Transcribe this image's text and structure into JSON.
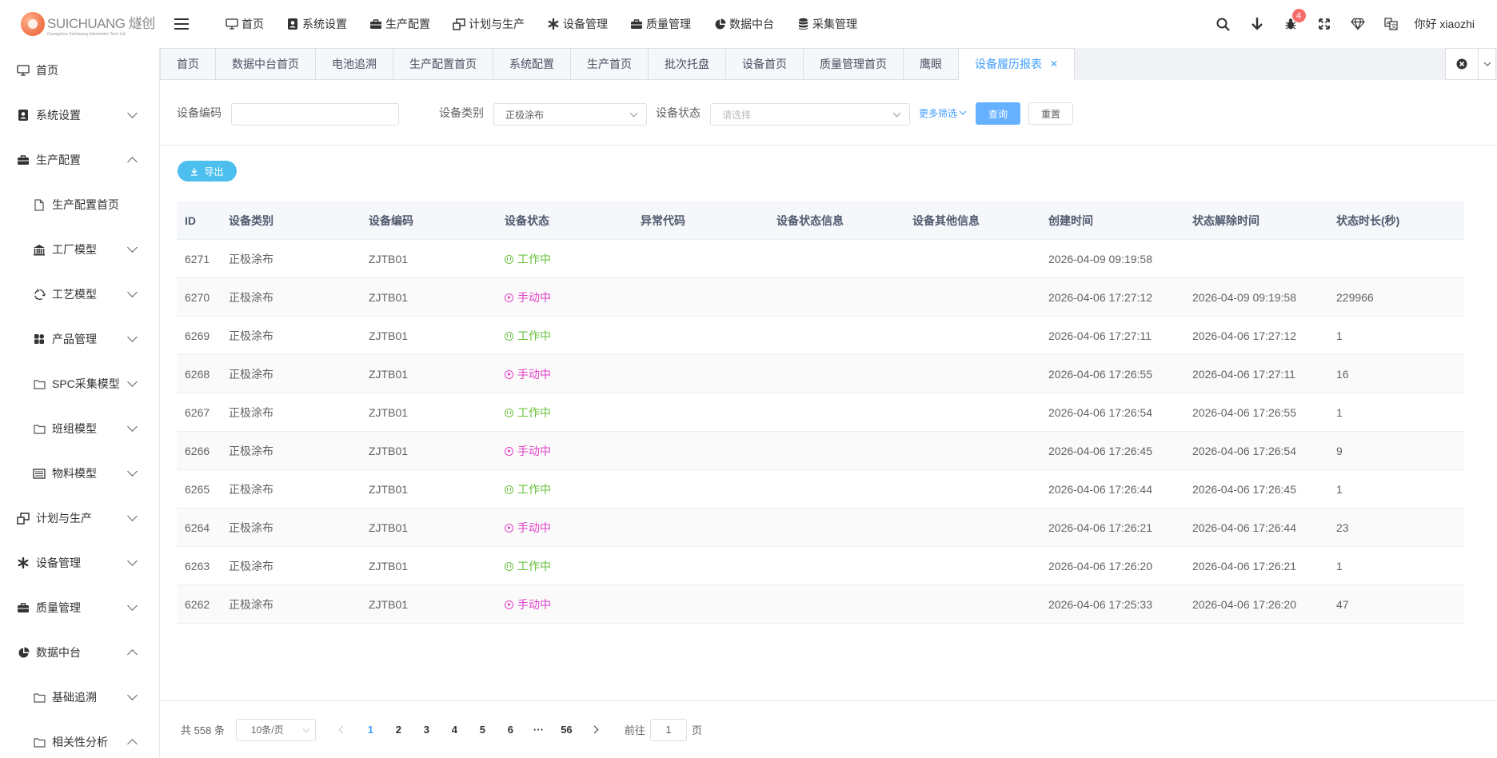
{
  "logo": {
    "name": "SUICHUANG 燧创",
    "sub": "Guangzhou Suichuang Information Tech Ltd"
  },
  "topnav": [
    {
      "label": "首页",
      "icon": "monitor-icon"
    },
    {
      "label": "系统设置",
      "icon": "user-badge-icon"
    },
    {
      "label": "生产配置",
      "icon": "briefcase-icon"
    },
    {
      "label": "计划与生产",
      "icon": "windows-icon"
    },
    {
      "label": "设备管理",
      "icon": "asterisk-icon"
    },
    {
      "label": "质量管理",
      "icon": "briefcase-icon"
    },
    {
      "label": "数据中台",
      "icon": "pie-chart-icon"
    },
    {
      "label": "采集管理",
      "icon": "database-icon"
    }
  ],
  "top_right": {
    "badge_count": "4",
    "greeting": "你好 xiaozhi"
  },
  "sidebar": [
    {
      "label": "首页",
      "icon": "monitor-icon",
      "level": 1,
      "chevron": ""
    },
    {
      "label": "系统设置",
      "icon": "user-badge-icon",
      "level": 1,
      "chevron": "down"
    },
    {
      "label": "生产配置",
      "icon": "briefcase-icon",
      "level": 1,
      "chevron": "up"
    },
    {
      "label": "生产配置首页",
      "icon": "document-icon",
      "level": 2,
      "chevron": ""
    },
    {
      "label": "工厂模型",
      "icon": "bank-icon",
      "level": 2,
      "chevron": "down"
    },
    {
      "label": "工艺模型",
      "icon": "recycle-icon",
      "level": 2,
      "chevron": "down"
    },
    {
      "label": "产品管理",
      "icon": "grid-icon",
      "level": 2,
      "chevron": "down"
    },
    {
      "label": "SPC采集模型",
      "icon": "folder-icon",
      "level": 2,
      "chevron": "down"
    },
    {
      "label": "班组模型",
      "icon": "folder-icon",
      "level": 2,
      "chevron": "down"
    },
    {
      "label": "物料模型",
      "icon": "list-box-icon",
      "level": 2,
      "chevron": "down"
    },
    {
      "label": "计划与生产",
      "icon": "windows-icon",
      "level": 1,
      "chevron": "down"
    },
    {
      "label": "设备管理",
      "icon": "asterisk-icon",
      "level": 1,
      "chevron": "down"
    },
    {
      "label": "质量管理",
      "icon": "briefcase-icon",
      "level": 1,
      "chevron": "down"
    },
    {
      "label": "数据中台",
      "icon": "pie-chart-icon",
      "level": 1,
      "chevron": "up"
    },
    {
      "label": "基础追溯",
      "icon": "folder-icon",
      "level": 2,
      "chevron": "down"
    },
    {
      "label": "相关性分析",
      "icon": "folder-icon",
      "level": 2,
      "chevron": "up"
    }
  ],
  "tabs": [
    {
      "label": "首页",
      "active": false
    },
    {
      "label": "数据中台首页",
      "active": false
    },
    {
      "label": "电池追溯",
      "active": false
    },
    {
      "label": "生产配置首页",
      "active": false
    },
    {
      "label": "系统配置",
      "active": false
    },
    {
      "label": "生产首页",
      "active": false
    },
    {
      "label": "批次托盘",
      "active": false
    },
    {
      "label": "设备首页",
      "active": false
    },
    {
      "label": "质量管理首页",
      "active": false
    },
    {
      "label": "鹰眼",
      "active": false
    },
    {
      "label": "设备履历报表",
      "active": true
    }
  ],
  "filters": {
    "code_label": "设备编码",
    "code_value": "",
    "category_label": "设备类别",
    "category_value": "正极涂布",
    "status_label": "设备状态",
    "status_placeholder": "请选择",
    "more_label": "更多筛选",
    "query_label": "查询",
    "reset_label": "重置"
  },
  "export_label": "导出",
  "colors": {
    "working": "#67c23a",
    "manual": "#e040c8",
    "primary": "#409eff"
  },
  "table": {
    "columns": [
      "ID",
      "设备类别",
      "设备编码",
      "设备状态",
      "异常代码",
      "设备状态信息",
      "设备其他信息",
      "创建时间",
      "状态解除时间",
      "状态时长(秒)"
    ],
    "rows": [
      {
        "id": "6271",
        "category": "正极涂布",
        "code": "ZJTB01",
        "status": "工作中",
        "status_type": "working",
        "err": "",
        "status_info": "",
        "other": "",
        "created": "2026-04-09 09:19:58",
        "released": "",
        "duration": ""
      },
      {
        "id": "6270",
        "category": "正极涂布",
        "code": "ZJTB01",
        "status": "手动中",
        "status_type": "manual",
        "err": "",
        "status_info": "",
        "other": "",
        "created": "2026-04-06 17:27:12",
        "released": "2026-04-09 09:19:58",
        "duration": "229966"
      },
      {
        "id": "6269",
        "category": "正极涂布",
        "code": "ZJTB01",
        "status": "工作中",
        "status_type": "working",
        "err": "",
        "status_info": "",
        "other": "",
        "created": "2026-04-06 17:27:11",
        "released": "2026-04-06 17:27:12",
        "duration": "1"
      },
      {
        "id": "6268",
        "category": "正极涂布",
        "code": "ZJTB01",
        "status": "手动中",
        "status_type": "manual",
        "err": "",
        "status_info": "",
        "other": "",
        "created": "2026-04-06 17:26:55",
        "released": "2026-04-06 17:27:11",
        "duration": "16"
      },
      {
        "id": "6267",
        "category": "正极涂布",
        "code": "ZJTB01",
        "status": "工作中",
        "status_type": "working",
        "err": "",
        "status_info": "",
        "other": "",
        "created": "2026-04-06 17:26:54",
        "released": "2026-04-06 17:26:55",
        "duration": "1"
      },
      {
        "id": "6266",
        "category": "正极涂布",
        "code": "ZJTB01",
        "status": "手动中",
        "status_type": "manual",
        "err": "",
        "status_info": "",
        "other": "",
        "created": "2026-04-06 17:26:45",
        "released": "2026-04-06 17:26:54",
        "duration": "9"
      },
      {
        "id": "6265",
        "category": "正极涂布",
        "code": "ZJTB01",
        "status": "工作中",
        "status_type": "working",
        "err": "",
        "status_info": "",
        "other": "",
        "created": "2026-04-06 17:26:44",
        "released": "2026-04-06 17:26:45",
        "duration": "1"
      },
      {
        "id": "6264",
        "category": "正极涂布",
        "code": "ZJTB01",
        "status": "手动中",
        "status_type": "manual",
        "err": "",
        "status_info": "",
        "other": "",
        "created": "2026-04-06 17:26:21",
        "released": "2026-04-06 17:26:44",
        "duration": "23"
      },
      {
        "id": "6263",
        "category": "正极涂布",
        "code": "ZJTB01",
        "status": "工作中",
        "status_type": "working",
        "err": "",
        "status_info": "",
        "other": "",
        "created": "2026-04-06 17:26:20",
        "released": "2026-04-06 17:26:21",
        "duration": "1"
      },
      {
        "id": "6262",
        "category": "正极涂布",
        "code": "ZJTB01",
        "status": "手动中",
        "status_type": "manual",
        "err": "",
        "status_info": "",
        "other": "",
        "created": "2026-04-06 17:25:33",
        "released": "2026-04-06 17:26:20",
        "duration": "47"
      }
    ]
  },
  "pagination": {
    "total": "共 558 条",
    "page_size": "10条/页",
    "pages": [
      "1",
      "2",
      "3",
      "4",
      "5",
      "6",
      "···",
      "56"
    ],
    "current": "1",
    "jump_prefix": "前往",
    "jump_value": "1",
    "jump_suffix": "页"
  }
}
